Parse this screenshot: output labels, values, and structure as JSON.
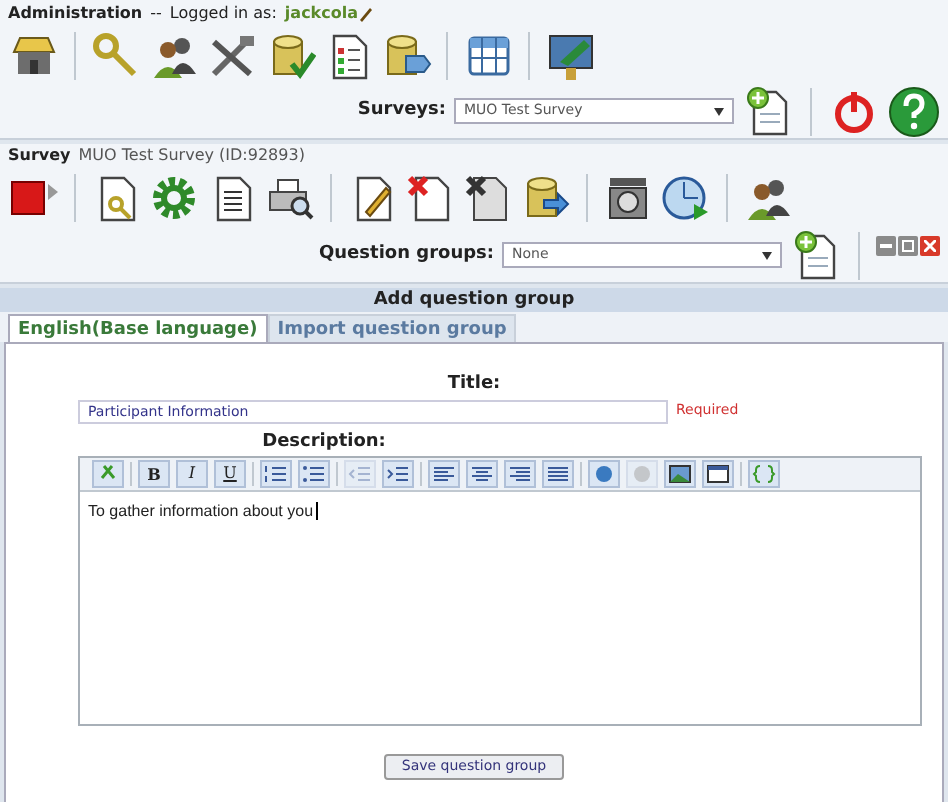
{
  "header": {
    "title": "Administration",
    "separator": "--",
    "logged_in_label": "Logged in as:",
    "user": "jackcola"
  },
  "surveys_selector": {
    "label": "Surveys:",
    "value": "MUO Test Survey"
  },
  "survey_bar": {
    "label": "Survey",
    "name": "MUO Test Survey (ID:92893)"
  },
  "question_groups_selector": {
    "label": "Question groups:",
    "value": "None"
  },
  "section_title": "Add question group",
  "tabs": [
    {
      "label": "English(Base language)",
      "selected": true
    },
    {
      "label": "Import question group",
      "selected": false
    }
  ],
  "form": {
    "title_label": "Title:",
    "title_value": "Participant Information",
    "required_note": "Required",
    "description_label": "Description:",
    "description_value": "To gather information about you"
  },
  "format_buttons": [
    {
      "label": "B",
      "kind": "bold"
    },
    {
      "label": "I",
      "kind": "italic"
    },
    {
      "label": "U",
      "kind": "underline"
    }
  ],
  "save_button": "Save question group"
}
